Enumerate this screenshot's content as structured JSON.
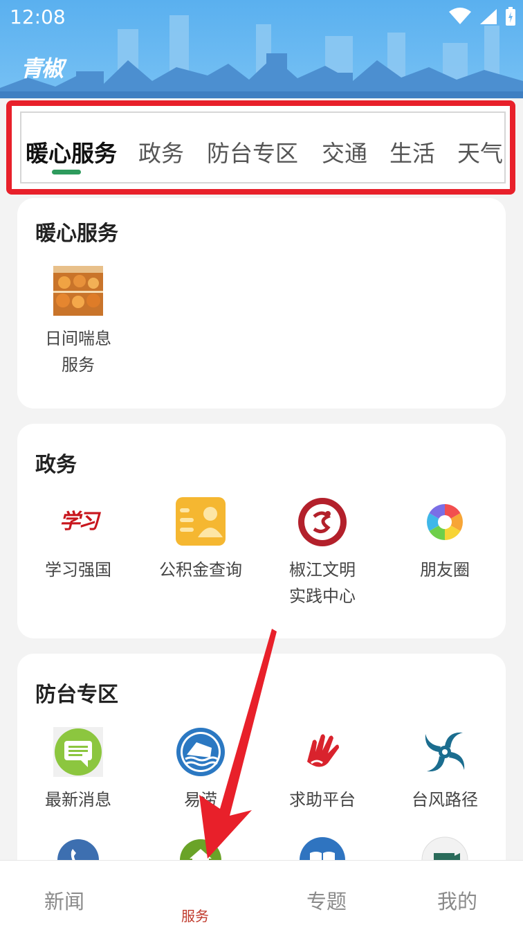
{
  "status_bar": {
    "time": "12:08"
  },
  "header": {
    "logo_text": "青椒"
  },
  "tabs": [
    {
      "label": "暖心服务",
      "active": true
    },
    {
      "label": "政务"
    },
    {
      "label": "防台专区"
    },
    {
      "label": "交通"
    },
    {
      "label": "生活"
    },
    {
      "label": "天气"
    }
  ],
  "sections": {
    "warm": {
      "title": "暖心服务",
      "items": [
        {
          "label_line1": "日间喘息",
          "label_line2": "服务",
          "icon": "bakery-photo-icon"
        }
      ]
    },
    "gov": {
      "title": "政务",
      "items": [
        {
          "label_line1": "学习强国",
          "label_line2": "",
          "icon": "xuexi-logo-icon",
          "icon_text": "学习"
        },
        {
          "label_line1": "公积金查询",
          "label_line2": "",
          "icon": "fund-card-icon"
        },
        {
          "label_line1": "椒江文明",
          "label_line2": "实践中心",
          "icon": "civilization-badge-icon"
        },
        {
          "label_line1": "朋友圈",
          "label_line2": "",
          "icon": "aperture-icon"
        }
      ]
    },
    "typhoon": {
      "title": "防台专区",
      "items": [
        {
          "label_line1": "最新消息",
          "label_line2": "",
          "icon": "message-bubble-icon"
        },
        {
          "label_line1": "易涝",
          "label_line2": "",
          "icon": "flood-house-icon"
        },
        {
          "label_line1": "求助平台",
          "label_line2": "",
          "icon": "helping-hand-icon"
        },
        {
          "label_line1": "台风路径",
          "label_line2": "",
          "icon": "typhoon-icon"
        }
      ],
      "row2_icons": [
        "phone-icon",
        "home-icon",
        "book-icon",
        "folder-icon"
      ]
    }
  },
  "bottom_nav": [
    {
      "label": "新闻"
    },
    {
      "label": "服务",
      "active": true
    },
    {
      "label": "专题"
    },
    {
      "label": "我的"
    }
  ],
  "colors": {
    "header_blue": "#5ab0ef",
    "tab_indicator": "#2e9b5d",
    "highlight_red": "#e8202a",
    "nav_active": "#c0392b"
  }
}
